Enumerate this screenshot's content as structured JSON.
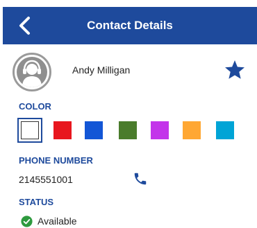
{
  "header": {
    "title": "Contact Details",
    "back_icon": "chevron-left-icon",
    "background": "#1e4a9c"
  },
  "contact": {
    "name": "Andy Milligan",
    "avatar_icon": "user-headset-icon",
    "favorite_icon": "star-icon",
    "favorite": true
  },
  "color_section": {
    "label": "COLOR",
    "selected_index": 0,
    "swatches": [
      {
        "name": "white",
        "hex": "#ffffff"
      },
      {
        "name": "red",
        "hex": "#e8161e"
      },
      {
        "name": "blue",
        "hex": "#1356d6"
      },
      {
        "name": "green",
        "hex": "#4a7c2c"
      },
      {
        "name": "purple",
        "hex": "#c334ea"
      },
      {
        "name": "orange",
        "hex": "#ffa733"
      },
      {
        "name": "cyan",
        "hex": "#00a4d6"
      }
    ]
  },
  "phone_section": {
    "label": "PHONE NUMBER",
    "number": "2145551001",
    "call_icon": "phone-icon"
  },
  "status_section": {
    "label": "STATUS",
    "value": "Available",
    "icon": "check-circle-icon",
    "icon_color": "#2e9a3e"
  }
}
